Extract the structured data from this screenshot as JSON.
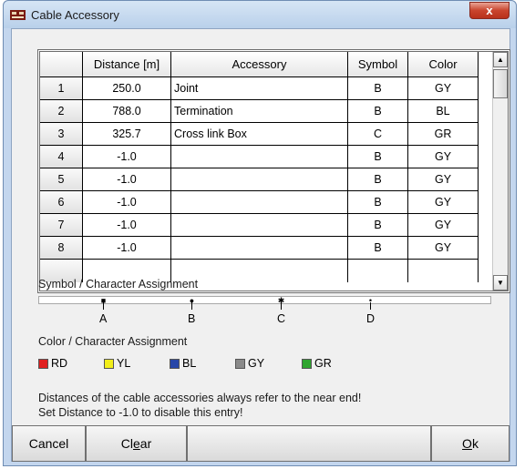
{
  "window": {
    "title": "Cable Accessory",
    "close_glyph": "x"
  },
  "table": {
    "headers": [
      "",
      "Distance [m]",
      "Accessory",
      "Symbol",
      "Color"
    ],
    "rows": [
      [
        "1",
        "250.0",
        "Joint",
        "B",
        "GY"
      ],
      [
        "2",
        "788.0",
        "Termination",
        "B",
        "BL"
      ],
      [
        "3",
        "325.7",
        "Cross link Box",
        "C",
        "GR"
      ],
      [
        "4",
        "-1.0",
        "",
        "B",
        "GY"
      ],
      [
        "5",
        "-1.0",
        "",
        "B",
        "GY"
      ],
      [
        "6",
        "-1.0",
        "",
        "B",
        "GY"
      ],
      [
        "7",
        "-1.0",
        "",
        "B",
        "GY"
      ],
      [
        "8",
        "-1.0",
        "",
        "B",
        "GY"
      ]
    ]
  },
  "symbols": {
    "title": "Symbol / Character Assignment",
    "items": [
      {
        "letter": "A",
        "glyph": "■"
      },
      {
        "letter": "B",
        "glyph": "●"
      },
      {
        "letter": "C",
        "glyph": "✱"
      },
      {
        "letter": "D",
        "glyph": "•"
      }
    ]
  },
  "colors": {
    "title": "Color / Character Assignment",
    "items": [
      {
        "code": "RD",
        "hex": "#e02020"
      },
      {
        "code": "YL",
        "hex": "#f2ee1a"
      },
      {
        "code": "BL",
        "hex": "#2746a8"
      },
      {
        "code": "GY",
        "hex": "#8a8a8a"
      },
      {
        "code": "GR",
        "hex": "#2fa52f"
      }
    ]
  },
  "notes": {
    "line1": "Distances of the cable accessories always refer to the near end!",
    "line2": "Set Distance to -1.0 to disable this entry!"
  },
  "buttons": {
    "cancel": "Cancel",
    "clear": "Clear",
    "ok": "Ok"
  }
}
